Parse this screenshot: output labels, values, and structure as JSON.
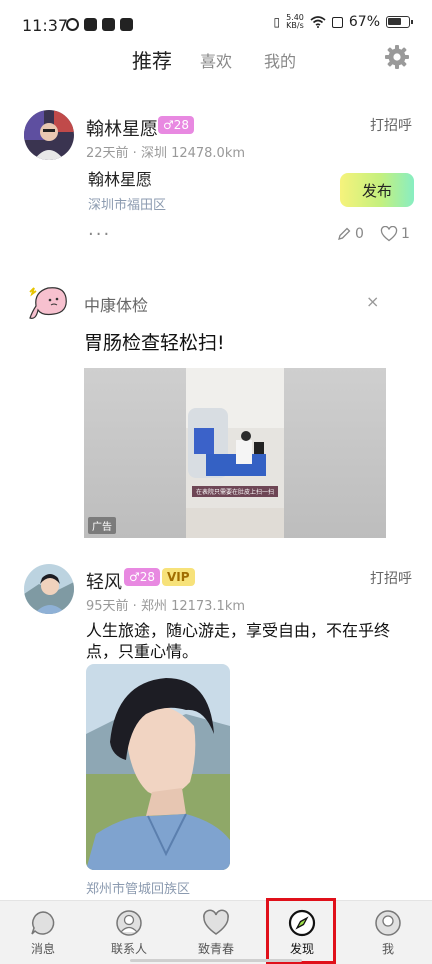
{
  "status_bar": {
    "time": "11:37",
    "net_speed_top": "5.40",
    "net_speed_bottom": "KB/s",
    "battery": "67%"
  },
  "tabs": [
    {
      "label": "推荐",
      "active": true
    },
    {
      "label": "喜欢",
      "active": false
    },
    {
      "label": "我的",
      "active": false
    }
  ],
  "posts": [
    {
      "name": "翰林星愿",
      "gender_age": "♂28",
      "greet": "打招呼",
      "meta": "22天前 · 深圳 12478.0km",
      "title": "翰林星愿",
      "location": "深圳市福田区",
      "publish_label": "发布",
      "more": "···",
      "comments": "0",
      "likes": "1"
    },
    {
      "name": "轻风",
      "gender_age": "♂28",
      "vip": "VIP",
      "greet": "打招呼",
      "meta": "95天前 · 郑州 12173.1km",
      "content": "人生旅途，随心游走，享受自由，不在乎终点，只重心情。",
      "location": "郑州市管城回族区"
    }
  ],
  "ad": {
    "brand": "中康体检",
    "close": "×",
    "headline": "胃肠检查轻松扫!",
    "tag": "广告",
    "caption": "在表院只需要在肚皮上扫一扫"
  },
  "bottom_nav": [
    {
      "label": "消息"
    },
    {
      "label": "联系人"
    },
    {
      "label": "致青春"
    },
    {
      "label": "发现",
      "active": true
    },
    {
      "label": "我"
    }
  ],
  "colors": {
    "accent_badge": "#e889e1",
    "vip": "#f7e27a",
    "highlight": "#e0101a"
  }
}
